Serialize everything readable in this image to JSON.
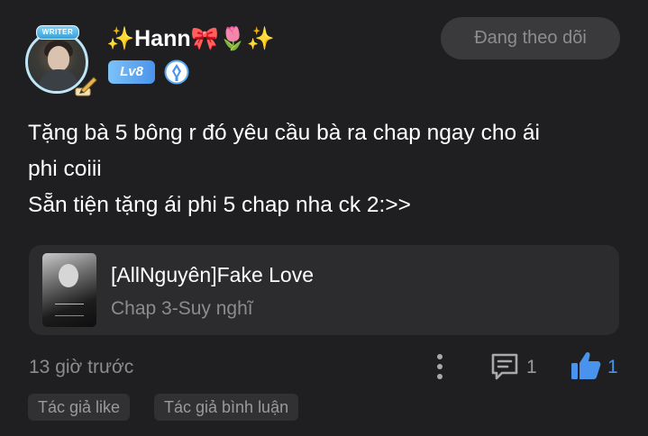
{
  "user": {
    "name": "✨Hann🎀🌷✨",
    "level": "Lv8",
    "frame_label": "WRITER",
    "follow_label": "Đang theo dõi"
  },
  "comment": {
    "lines": [
      "Tặng bà 5 bông r đó yêu cầu bà ra chap ngay cho ái",
      "phi coiii",
      "Sẵn tiện tặng ái phi 5 chap nha ck 2:>>"
    ]
  },
  "chapter_card": {
    "story_title": "[AllNguyên]Fake Love",
    "chapter": "Chap 3-Suy nghĩ"
  },
  "footer": {
    "time": "13 giờ trước",
    "reply_count": "1",
    "like_count": "1",
    "tags": [
      "Tác giả like",
      "Tác giả bình luận"
    ]
  },
  "colors": {
    "background": "#1f1f21",
    "card": "#2c2c2e",
    "accent": "#4a93ec",
    "muted_text": "#8c8c8f"
  },
  "icons": [
    "more-icon",
    "comment-icon",
    "thumbs-up-icon",
    "pen-icon",
    "author-badge-icon"
  ]
}
